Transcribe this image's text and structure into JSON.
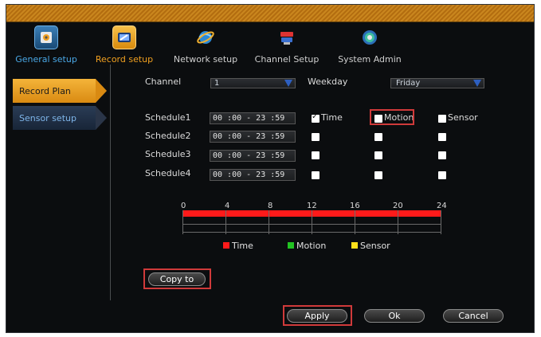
{
  "tabs": [
    {
      "label": "General setup",
      "icon": "gear-icon"
    },
    {
      "label": "Record setup",
      "icon": "record-icon"
    },
    {
      "label": "Network setup",
      "icon": "globe-icon"
    },
    {
      "label": "Channel Setup",
      "icon": "camera-icon"
    },
    {
      "label": "System Admin",
      "icon": "admin-icon"
    }
  ],
  "sidebar": {
    "items": [
      {
        "label": "Record Plan",
        "active": true
      },
      {
        "label": "Sensor setup",
        "active": false
      }
    ]
  },
  "form": {
    "channel_label": "Channel",
    "channel_value": "1",
    "weekday_label": "Weekday",
    "weekday_value": "Friday"
  },
  "schedules": [
    {
      "label": "Schedule1",
      "time": "00 :00 - 23 :59",
      "time_checked": true,
      "motion_checked": false,
      "sensor_checked": false
    },
    {
      "label": "Schedule2",
      "time": "00 :00 - 23 :59",
      "time_checked": false,
      "motion_checked": false,
      "sensor_checked": false
    },
    {
      "label": "Schedule3",
      "time": "00 :00 - 23 :59",
      "time_checked": false,
      "motion_checked": false,
      "sensor_checked": false
    },
    {
      "label": "Schedule4",
      "time": "00 :00 - 23 :59",
      "time_checked": false,
      "motion_checked": false,
      "sensor_checked": false
    }
  ],
  "checkbox_labels": {
    "time": "Time",
    "motion": "Motion",
    "sensor": "Sensor"
  },
  "timeline": {
    "hours": [
      "0",
      "4",
      "8",
      "12",
      "16",
      "20",
      "24"
    ]
  },
  "legend": [
    {
      "label": "Time",
      "color": "#ff1a1a"
    },
    {
      "label": "Motion",
      "color": "#22c322"
    },
    {
      "label": "Sensor",
      "color": "#ffe01a"
    }
  ],
  "buttons": {
    "copy_to": "Copy to",
    "apply": "Apply",
    "ok": "Ok",
    "cancel": "Cancel"
  },
  "colors": {
    "accent_orange": "#f0a020",
    "accent_blue": "#4aa8e6",
    "highlight_red": "#d03a3a"
  }
}
